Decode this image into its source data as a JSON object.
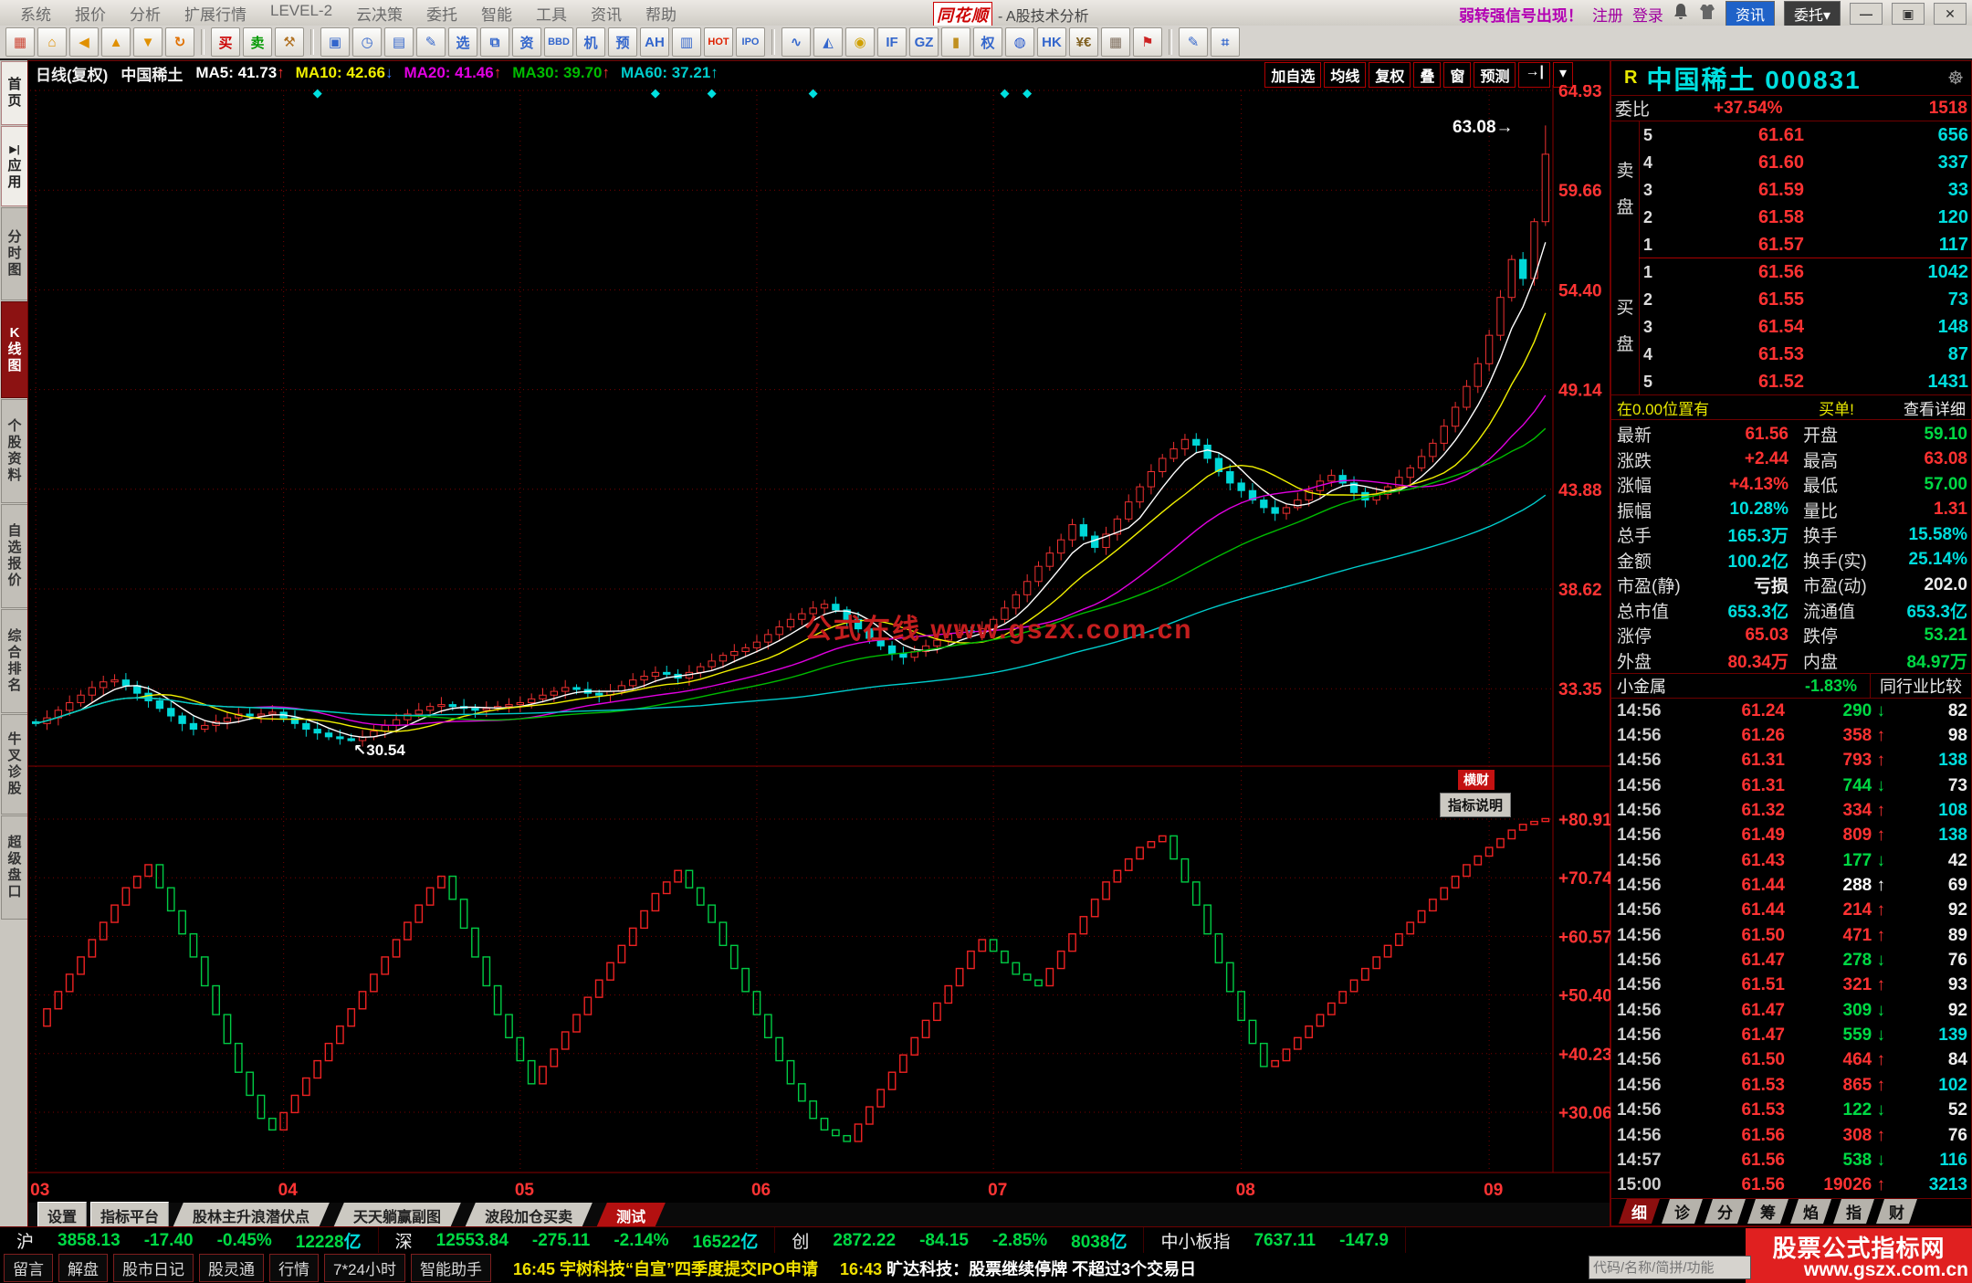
{
  "window": {
    "logo": "同花顺",
    "title": "- A股技术分析",
    "alert": "弱转强信号出现！",
    "register": "注册",
    "login": "登录",
    "zixun_btn": "资讯",
    "weituo_btn": "委托▾",
    "win_buttons": [
      "—",
      "▣",
      "×"
    ],
    "title_icons": [
      "bell-icon",
      "vest-icon"
    ]
  },
  "menu": {
    "items": [
      "系统",
      "报价",
      "分析",
      "扩展行情",
      "LEVEL-2",
      "云决策",
      "委托",
      "智能",
      "工具",
      "资讯",
      "帮助"
    ]
  },
  "toolbar": {
    "icons": [
      {
        "name": "desktop-icon",
        "glyph": "▦",
        "color": "#cc4433"
      },
      {
        "name": "home-icon",
        "glyph": "⌂",
        "color": "#e09000"
      },
      {
        "name": "back-icon",
        "glyph": "◀",
        "color": "#e09000"
      },
      {
        "name": "up-icon",
        "glyph": "▲",
        "color": "#e09000"
      },
      {
        "name": "down-icon",
        "glyph": "▼",
        "color": "#e09000"
      },
      {
        "name": "refresh-icon",
        "glyph": "↻",
        "color": "#e07000"
      },
      {
        "sep": true
      },
      {
        "name": "buy-icon",
        "glyph": "买",
        "color": "#cc0000"
      },
      {
        "name": "sell-icon",
        "glyph": "卖",
        "color": "#009900"
      },
      {
        "name": "auction-icon",
        "glyph": "⚒",
        "color": "#b07020"
      },
      {
        "sep": true
      },
      {
        "name": "favorites-icon",
        "glyph": "▣",
        "color": "#3366cc"
      },
      {
        "name": "clock-icon",
        "glyph": "◷",
        "color": "#3366cc"
      },
      {
        "name": "report-icon",
        "glyph": "▤",
        "color": "#3366cc"
      },
      {
        "name": "edit-icon",
        "glyph": "✎",
        "color": "#3366cc"
      },
      {
        "name": "select-icon",
        "glyph": "选",
        "color": "#3366cc"
      },
      {
        "name": "docs-icon",
        "glyph": "⧉",
        "color": "#3366cc"
      },
      {
        "name": "info-icon",
        "glyph": "资",
        "color": "#3366cc"
      },
      {
        "name": "bbd-icon",
        "glyph": "BBD",
        "color": "#3366cc"
      },
      {
        "name": "machine-icon",
        "glyph": "机",
        "color": "#3366cc"
      },
      {
        "name": "forecast-icon",
        "glyph": "预",
        "color": "#3366cc"
      },
      {
        "name": "ah-icon",
        "glyph": "AH",
        "color": "#3366cc"
      },
      {
        "name": "note-icon",
        "glyph": "▥",
        "color": "#3366cc"
      },
      {
        "name": "hot-icon",
        "glyph": "HOT",
        "color": "#dd2200"
      },
      {
        "name": "ipo-icon",
        "glyph": "IPO",
        "color": "#3366cc"
      },
      {
        "sep": true
      },
      {
        "name": "kline-icon",
        "glyph": "∿",
        "color": "#3366cc"
      },
      {
        "name": "trend-icon",
        "glyph": "◭",
        "color": "#3366cc"
      },
      {
        "name": "coin-icon",
        "glyph": "◉",
        "color": "#d0a000"
      },
      {
        "name": "if-icon",
        "glyph": "IF",
        "color": "#3366cc"
      },
      {
        "name": "gz-icon",
        "glyph": "GZ",
        "color": "#3366cc"
      },
      {
        "name": "gold-icon",
        "glyph": "▮",
        "color": "#c09020"
      },
      {
        "name": "rights-icon",
        "glyph": "权",
        "color": "#3366cc"
      },
      {
        "name": "globe-icon",
        "glyph": "◍",
        "color": "#2255cc"
      },
      {
        "name": "hk-icon",
        "glyph": "HK",
        "color": "#3366cc"
      },
      {
        "name": "forex-icon",
        "glyph": "¥€",
        "color": "#806020"
      },
      {
        "name": "bank-icon",
        "glyph": "▦",
        "color": "#807060"
      },
      {
        "name": "us-flag-icon",
        "glyph": "⚑",
        "color": "#cc2222"
      },
      {
        "sep": true
      },
      {
        "name": "formula-edit-icon",
        "glyph": "✎",
        "color": "#3366cc"
      },
      {
        "name": "calculator-icon",
        "glyph": "⌗",
        "color": "#3366cc"
      }
    ]
  },
  "sidebar": {
    "items": [
      {
        "label": "首页",
        "style": "light"
      },
      {
        "label": "应用",
        "style": "light",
        "icon": "▶|"
      },
      {
        "label": "分时图",
        "style": "gray"
      },
      {
        "label": "K线图",
        "style": "active"
      },
      {
        "label": "个股资料",
        "style": "gray"
      },
      {
        "label": "自选报价",
        "style": "gray"
      },
      {
        "label": "综合排名",
        "style": "gray"
      },
      {
        "label": "牛叉诊股",
        "style": "gray"
      },
      {
        "label": "超级盘口",
        "style": "gray"
      }
    ]
  },
  "chart": {
    "header": {
      "period": "日线(复权)",
      "stock": "中国稀土",
      "mas": [
        {
          "text": "MA5: 41.73",
          "color": "#ffffff",
          "arrow": "↑",
          "acolor": "#ff3232"
        },
        {
          "text": "MA10: 42.66",
          "color": "#f0f000",
          "arrow": "↓",
          "acolor": "#3b7bff"
        },
        {
          "text": "MA20: 41.46",
          "color": "#e000e0",
          "arrow": "↑",
          "acolor": "#ff3232"
        },
        {
          "text": "MA30: 39.70",
          "color": "#00bb00",
          "arrow": "↑",
          "acolor": "#ff3232"
        },
        {
          "text": "MA60: 37.21",
          "color": "#00cccc",
          "arrow": "↑",
          "acolor": "#00cccc"
        }
      ],
      "buttons": [
        "加自选",
        "均线",
        "复权",
        "叠",
        "窗",
        "预测",
        "→|",
        "▾"
      ]
    },
    "y_axis_main": [
      "64.93",
      "59.66",
      "54.40",
      "49.14",
      "43.88",
      "38.62",
      "33.35"
    ],
    "y_axis_sub": [
      "+80.91",
      "+70.74",
      "+60.57",
      "+50.40",
      "+40.23",
      "+30.06"
    ],
    "months": [
      "03",
      "04",
      "05",
      "06",
      "07",
      "08",
      "09"
    ],
    "month_start_idx": [
      0,
      22,
      43,
      64,
      85,
      107,
      129
    ],
    "annotations": {
      "high": "63.08→",
      "low": "↖30.54",
      "watermark": "公式在线 www.gszx.com.cn",
      "badge": "横财",
      "indicator_help": "指标说明"
    },
    "value_range_main": [
      64.93,
      33.35
    ],
    "value_range_sub": [
      80.91,
      30.06
    ],
    "closes": [
      31.5,
      31.8,
      32.2,
      32.6,
      33.0,
      33.4,
      33.7,
      33.8,
      33.5,
      33.1,
      32.7,
      32.3,
      31.9,
      31.5,
      31.2,
      31.4,
      31.6,
      31.8,
      32.0,
      31.9,
      32.0,
      32.1,
      31.8,
      31.5,
      31.2,
      31.0,
      30.8,
      30.7,
      30.6,
      30.8,
      31.1,
      31.4,
      31.7,
      32.0,
      32.2,
      32.4,
      32.5,
      32.4,
      32.3,
      32.2,
      32.3,
      32.4,
      32.5,
      32.6,
      32.8,
      33.0,
      33.2,
      33.4,
      33.3,
      33.1,
      33.0,
      33.2,
      33.5,
      33.8,
      34.0,
      34.2,
      34.1,
      33.9,
      34.2,
      34.5,
      34.8,
      35.1,
      35.3,
      35.5,
      35.8,
      36.2,
      36.6,
      37.0,
      37.3,
      37.6,
      37.8,
      37.5,
      37.0,
      36.5,
      36.0,
      35.6,
      35.2,
      35.0,
      35.3,
      35.6,
      35.9,
      36.2,
      36.4,
      36.3,
      36.5,
      37.0,
      37.6,
      38.3,
      39.0,
      39.8,
      40.5,
      41.2,
      42.0,
      41.4,
      40.8,
      41.5,
      42.3,
      43.2,
      44.0,
      44.8,
      45.5,
      46.0,
      46.5,
      46.2,
      45.5,
      44.8,
      44.2,
      43.8,
      43.3,
      42.9,
      42.6,
      42.9,
      43.3,
      43.8,
      44.3,
      44.6,
      44.2,
      43.7,
      43.3,
      43.6,
      44.0,
      44.5,
      45.0,
      45.6,
      46.3,
      47.2,
      48.2,
      49.3,
      50.5,
      52.0,
      54.0,
      56.0,
      55.0,
      58.0,
      61.56
    ],
    "indicator": [
      45,
      48,
      51,
      54,
      57,
      60,
      63,
      66,
      69,
      71,
      73,
      69,
      65,
      61,
      57,
      52,
      47,
      42,
      37,
      33,
      29,
      27,
      30,
      33,
      36,
      39,
      42,
      45,
      48,
      51,
      54,
      57,
      60,
      63,
      66,
      69,
      71,
      67,
      62,
      57,
      52,
      47,
      43,
      39,
      35,
      38,
      41,
      44,
      47,
      50,
      53,
      56,
      59,
      62,
      65,
      68,
      70,
      72,
      69,
      66,
      63,
      59,
      55,
      51,
      47,
      43,
      39,
      35,
      32,
      29,
      27,
      26,
      25,
      28,
      31,
      34,
      37,
      40,
      43,
      46,
      49,
      52,
      55,
      58,
      60,
      58,
      56,
      54,
      53,
      52,
      55,
      58,
      61,
      64,
      67,
      70,
      72,
      74,
      76,
      77,
      78,
      74,
      70,
      66,
      61,
      56,
      51,
      46,
      42,
      38,
      39,
      41,
      43,
      45,
      47,
      49,
      51,
      53,
      55,
      57,
      59,
      61,
      63,
      65,
      67,
      69,
      71,
      73,
      74.5,
      76,
      77.5,
      79,
      80,
      80.5,
      81
    ],
    "low_override": {
      "28": 30.54
    },
    "high_override": {
      "134": 63.08
    },
    "diamond_days": [
      25,
      55,
      60,
      69,
      86,
      88
    ],
    "colors": {
      "up": "#ee3030",
      "down": "#00d8d8",
      "grid": "#7a0101",
      "axis_text": "#ff3434",
      "ma": [
        "#ffffff",
        "#f0f000",
        "#e000e0",
        "#00bb00",
        "#00cccc"
      ],
      "ind_up": "#ee2222",
      "ind_down": "#00cc44",
      "watermark": "#c41e1e"
    }
  },
  "panel": {
    "flag": "R",
    "name_code": "中国稀土 000831",
    "weibi": {
      "label": "委比",
      "value": "+37.54%",
      "extra": "1518"
    },
    "sell_label": "卖盘",
    "buy_label": "买盘",
    "sell": [
      [
        "5",
        "61.61",
        "656"
      ],
      [
        "4",
        "61.60",
        "337"
      ],
      [
        "3",
        "61.59",
        "33"
      ],
      [
        "2",
        "61.58",
        "120"
      ],
      [
        "1",
        "61.57",
        "117"
      ]
    ],
    "buy": [
      [
        "1",
        "61.56",
        "1042"
      ],
      [
        "2",
        "61.55",
        "73"
      ],
      [
        "3",
        "61.54",
        "148"
      ],
      [
        "4",
        "61.53",
        "87"
      ],
      [
        "5",
        "61.52",
        "1431"
      ]
    ],
    "note": {
      "left": "在0.00位置有",
      "mid": "买单!",
      "right": "查看详细"
    },
    "details": [
      {
        "l": "最新",
        "lv": "61.56",
        "lc": "r",
        "r": "开盘",
        "rv": "59.10",
        "rc": "g"
      },
      {
        "l": "涨跌",
        "lv": "+2.44",
        "lc": "r",
        "r": "最高",
        "rv": "63.08",
        "rc": "r"
      },
      {
        "l": "涨幅",
        "lv": "+4.13%",
        "lc": "r",
        "r": "最低",
        "rv": "57.00",
        "rc": "g"
      },
      {
        "l": "振幅",
        "lv": "10.28%",
        "lc": "c",
        "r": "量比",
        "rv": "1.31",
        "rc": "r"
      },
      {
        "l": "总手",
        "lv": "165.3万",
        "lc": "c",
        "r": "换手",
        "rv": "15.58%",
        "rc": "c"
      },
      {
        "l": "金额",
        "lv": "100.2亿",
        "lc": "c",
        "r": "换手(实)",
        "rv": "25.14%",
        "rc": "c"
      },
      {
        "l": "市盈(静)",
        "lv": "亏损",
        "lc": "w",
        "r": "市盈(动)",
        "rv": "202.0",
        "rc": "w"
      },
      {
        "l": "总市值",
        "lv": "653.3亿",
        "lc": "c",
        "r": "流通值",
        "rv": "653.3亿",
        "rc": "c"
      },
      {
        "l": "涨停",
        "lv": "65.03",
        "lc": "r",
        "r": "跌停",
        "rv": "53.21",
        "rc": "g"
      },
      {
        "l": "外盘",
        "lv": "80.34万",
        "lc": "r",
        "r": "内盘",
        "rv": "84.97万",
        "rc": "g"
      }
    ],
    "industry": {
      "name": "小金属",
      "chg": "-1.83%",
      "link": "同行业比较"
    },
    "ticks": [
      {
        "t": "14:56",
        "p": "61.24",
        "v": "290",
        "dir": "down",
        "n": "82",
        "nc": false,
        "hl": false
      },
      {
        "t": "14:56",
        "p": "61.26",
        "v": "358",
        "dir": "up",
        "n": "98",
        "nc": false,
        "hl": false
      },
      {
        "t": "14:56",
        "p": "61.31",
        "v": "793",
        "dir": "up",
        "n": "138",
        "nc": true,
        "hl": false
      },
      {
        "t": "14:56",
        "p": "61.31",
        "v": "744",
        "dir": "down",
        "n": "73",
        "nc": false,
        "hl": false
      },
      {
        "t": "14:56",
        "p": "61.32",
        "v": "334",
        "dir": "up",
        "n": "108",
        "nc": true,
        "hl": false
      },
      {
        "t": "14:56",
        "p": "61.49",
        "v": "809",
        "dir": "up",
        "n": "138",
        "nc": true,
        "hl": false
      },
      {
        "t": "14:56",
        "p": "61.43",
        "v": "177",
        "dir": "down",
        "n": "42",
        "nc": false,
        "hl": false
      },
      {
        "t": "14:56",
        "p": "61.44",
        "v": "288",
        "dir": "up",
        "n": "69",
        "nc": false,
        "hl": true
      },
      {
        "t": "14:56",
        "p": "61.44",
        "v": "214",
        "dir": "up",
        "n": "92",
        "nc": false,
        "hl": false
      },
      {
        "t": "14:56",
        "p": "61.50",
        "v": "471",
        "dir": "up",
        "n": "89",
        "nc": false,
        "hl": false
      },
      {
        "t": "14:56",
        "p": "61.47",
        "v": "278",
        "dir": "down",
        "n": "76",
        "nc": false,
        "hl": false
      },
      {
        "t": "14:56",
        "p": "61.51",
        "v": "321",
        "dir": "up",
        "n": "93",
        "nc": false,
        "hl": false
      },
      {
        "t": "14:56",
        "p": "61.47",
        "v": "309",
        "dir": "down",
        "n": "92",
        "nc": false,
        "hl": false
      },
      {
        "t": "14:56",
        "p": "61.47",
        "v": "559",
        "dir": "down",
        "n": "139",
        "nc": true,
        "hl": false
      },
      {
        "t": "14:56",
        "p": "61.50",
        "v": "464",
        "dir": "up",
        "n": "84",
        "nc": false,
        "hl": false
      },
      {
        "t": "14:56",
        "p": "61.53",
        "v": "865",
        "dir": "up",
        "n": "102",
        "nc": true,
        "hl": false
      },
      {
        "t": "14:56",
        "p": "61.53",
        "v": "122",
        "dir": "down",
        "n": "52",
        "nc": false,
        "hl": false
      },
      {
        "t": "14:56",
        "p": "61.56",
        "v": "308",
        "dir": "up",
        "n": "76",
        "nc": false,
        "hl": false
      },
      {
        "t": "14:57",
        "p": "61.56",
        "v": "538",
        "dir": "down",
        "n": "116",
        "nc": true,
        "hl": false
      },
      {
        "t": "15:00",
        "p": "61.56",
        "v": "19026",
        "dir": "up",
        "n": "3213",
        "nc": true,
        "hl": false
      }
    ],
    "tabs": [
      "细",
      "诊",
      "分",
      "筹",
      "焰",
      "指",
      "财"
    ]
  },
  "bottom": {
    "chart_tabs": [
      {
        "label": "设置",
        "type": "btn"
      },
      {
        "label": "指标平台",
        "type": "btn"
      },
      {
        "label": "股林主升浪潜伏点",
        "type": "trap"
      },
      {
        "label": "天天躺赢副图",
        "type": "trap"
      },
      {
        "label": "波段加仓买卖",
        "type": "trap"
      },
      {
        "label": "测试",
        "type": "trap-active"
      }
    ],
    "indices": [
      {
        "name": "沪",
        "value": "3858.13",
        "chg": "-17.40",
        "pct": "-0.45%",
        "amt": "12228",
        "unit": "亿"
      },
      {
        "name": "深",
        "value": "12553.84",
        "chg": "-275.11",
        "pct": "-2.14%",
        "amt": "16522",
        "unit": "亿"
      },
      {
        "name": "创",
        "value": "2872.22",
        "chg": "-84.15",
        "pct": "-2.85%",
        "amt": "8038",
        "unit": "亿"
      },
      {
        "name": "中小板指",
        "value": "7637.11",
        "chg": "-147.9",
        "pct": "",
        "amt": "",
        "unit": ""
      }
    ],
    "left_buttons": [
      "留言",
      "解盘",
      "股市日记",
      "股灵通",
      "行情",
      "7*24小时",
      "智能助手"
    ],
    "news": [
      {
        "time": "16:45",
        "text": "宇树科技“自宣”四季度提交IPO申请",
        "color": "#f0e000",
        "tcolor": "#f0e000"
      },
      {
        "time": "16:43",
        "text": "旷达科技：股票继续停牌 不超过3个交易日",
        "color": "#ffffff",
        "tcolor": "#f0e000"
      }
    ],
    "search_placeholder": "代码/名称/简拼/功能",
    "ad": {
      "line1": "股票公式指标网",
      "line2": "www.gszx.com.cn"
    }
  }
}
